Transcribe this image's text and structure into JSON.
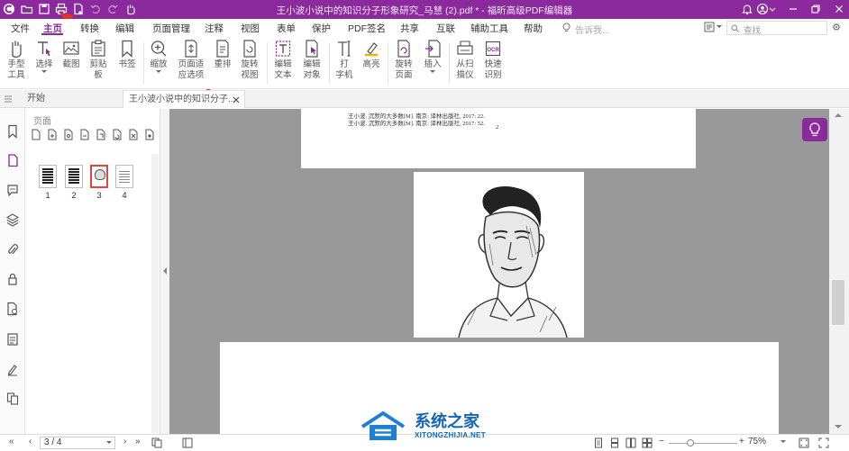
{
  "titlebar": {
    "title": "王小波小说中的知识分子形象研究_马慧 (2).pdf * - 福昕高级PDF编辑器",
    "accent": "#8a2a9c"
  },
  "menu": {
    "tabs": [
      "文件",
      "主页",
      "转换",
      "编辑",
      "页面管理",
      "注释",
      "视图",
      "表单",
      "保护",
      "PDF签名",
      "共享",
      "互联",
      "辅助工具",
      "帮助"
    ],
    "active": "主页",
    "tell_me": "告诉我...",
    "search": "查找"
  },
  "ribbon": {
    "hand": "手型\n工具",
    "hand_l1": "手型",
    "hand_l2": "工具",
    "select": "选择",
    "crop": "截图",
    "clipboard_l1": "剪贴",
    "clipboard_l2": "板",
    "bookmark": "书签",
    "zoom": "缩放",
    "fit_l1": "页面适",
    "fit_l2": "应选项",
    "reflow": "重排",
    "rotate_l1": "旋转",
    "rotate_l2": "视图",
    "edit_text_l1": "编辑",
    "edit_text_l2": "文本",
    "edit_obj_l1": "编辑",
    "edit_obj_l2": "对象",
    "typewriter_l1": "打",
    "typewriter_l2": "字机",
    "highlight": "高亮",
    "rotate_page_l1": "旋转",
    "rotate_page_l2": "页面",
    "insert": "插入",
    "scan_l1": "从扫",
    "scan_l2": "描仪",
    "quick_l1": "快速",
    "quick_l2": "识别"
  },
  "doctabs": {
    "start": "开始",
    "doc": "王小波小说中的知识分子..."
  },
  "panel": {
    "title": "页面",
    "thumbs": [
      "1",
      "2",
      "3",
      "4"
    ],
    "selected": "3"
  },
  "page1": {
    "ref1": "王小波. 沉默的大多数[M]. 南京: 译林出版社, 2017: 22.",
    "ref2": "王小波. 沉默的大多数[M]. 南京: 译林出版社, 2017: 52.",
    "page_no": "2"
  },
  "statusbar": {
    "page": "3 / 4",
    "zoom": "75%"
  },
  "watermark": {
    "cn": "系统之家",
    "en": "XITONGZHIJIA.NET"
  }
}
